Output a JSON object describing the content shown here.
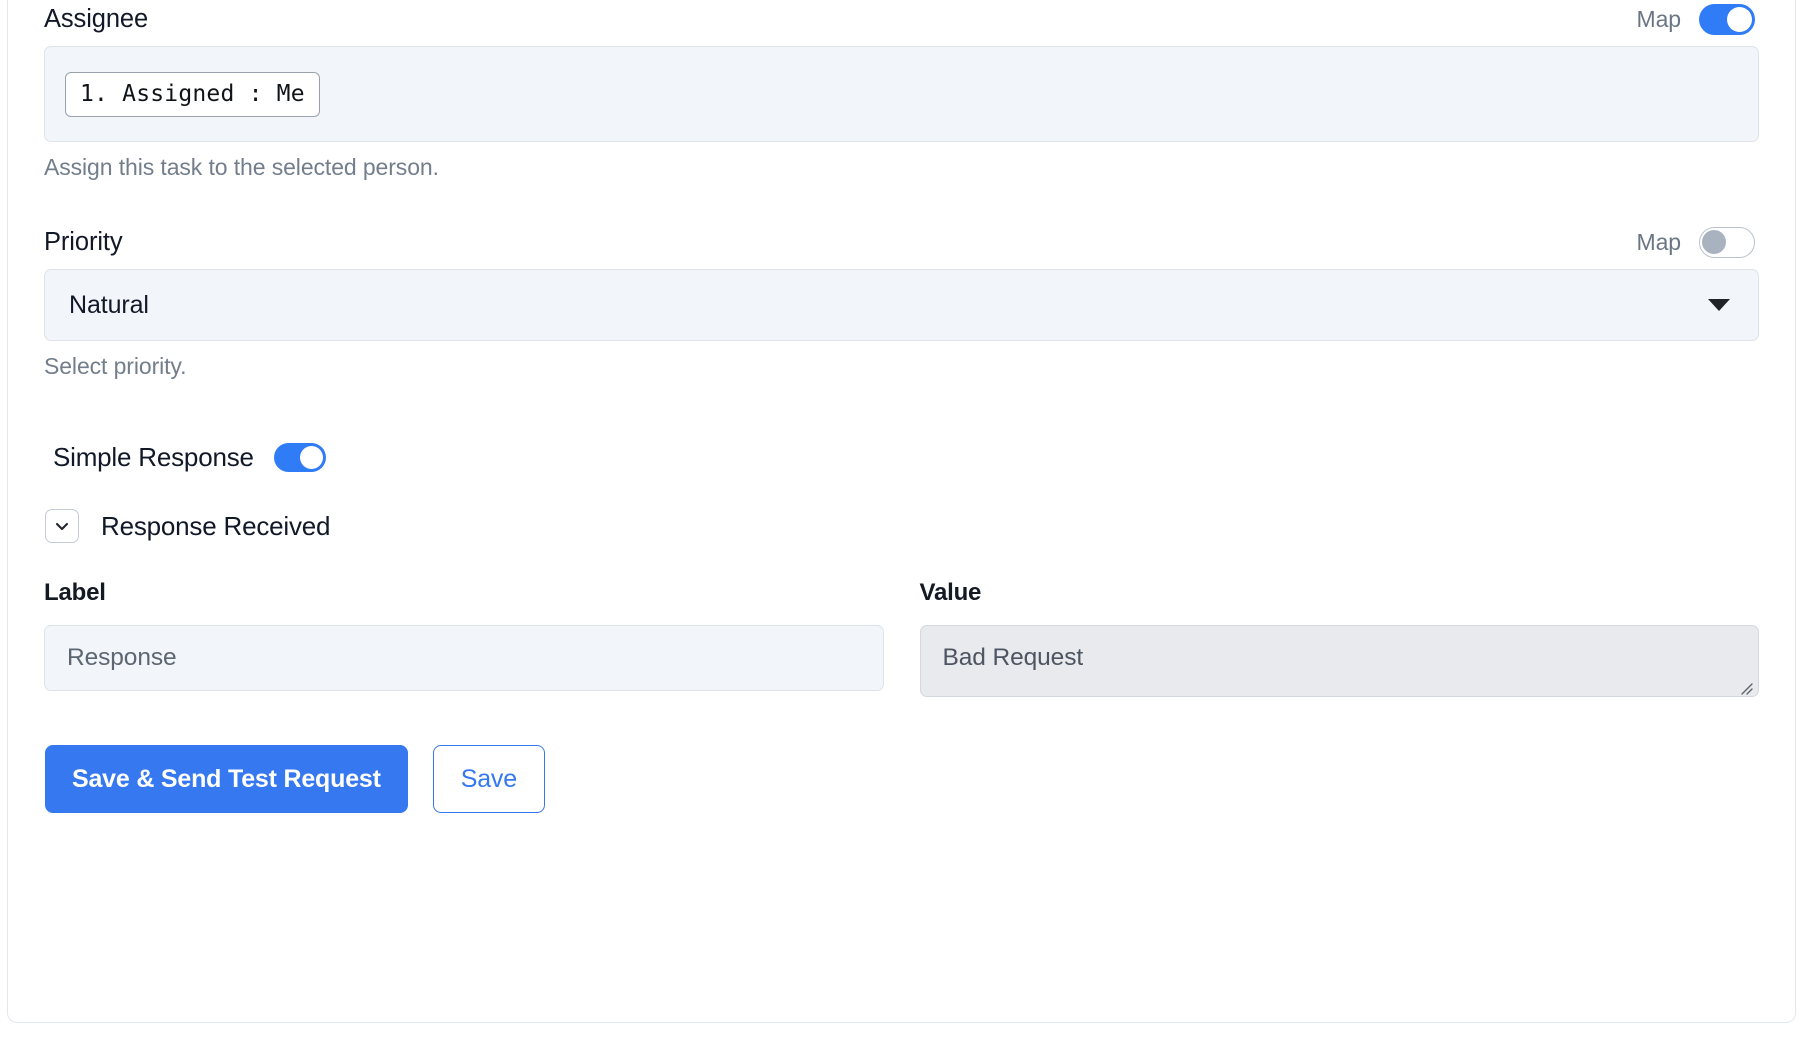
{
  "card": {
    "assignee": {
      "label": "Assignee",
      "map_label": "Map",
      "map_enabled": true,
      "chips": [
        {
          "text": "1. Assigned : Me"
        }
      ],
      "helper": "Assign this task to the selected person."
    },
    "priority": {
      "label": "Priority",
      "map_label": "Map",
      "map_enabled": false,
      "selected": "Natural",
      "helper": "Select priority."
    },
    "simple_response": {
      "label": "Simple Response",
      "enabled": true
    },
    "response_received": {
      "title": "Response Received",
      "expanded": true,
      "columns": {
        "label_header": "Label",
        "value_header": "Value"
      },
      "rows": [
        {
          "label": "Response",
          "value": "Bad Request"
        }
      ]
    },
    "actions": {
      "primary": "Save & Send Test Request",
      "secondary": "Save"
    }
  },
  "colors": {
    "accent": "#3578f0",
    "toggle_on": "#2f7cf6",
    "toggle_off": "#a9b3c0",
    "input_bg": "#f2f5f9",
    "textarea_bg": "#e8eaee",
    "muted_text": "#737e8c",
    "text": "#111827"
  }
}
